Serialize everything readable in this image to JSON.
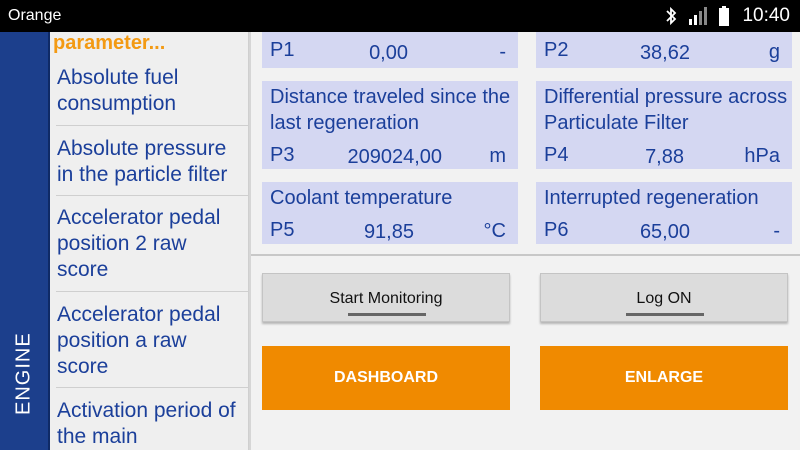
{
  "status_bar": {
    "carrier": "Orange",
    "time": "10:40"
  },
  "side_tab": {
    "label": "ENGINE"
  },
  "parameter_list": {
    "header": "parameter...",
    "items": [
      "Absolute fuel consumption",
      "Absolute pressure in the particle filter",
      "Accelerator pedal position 2 raw score",
      "Accelerator pedal position a raw score",
      "Activation period of the main"
    ]
  },
  "cells": {
    "p1": {
      "id": "P1",
      "value": "0,00",
      "unit": "-"
    },
    "p2": {
      "id": "P2",
      "value": "38,62",
      "unit": "g"
    },
    "p3": {
      "label": "Distance traveled since the last regeneration",
      "id": "P3",
      "value": "209024,00",
      "unit": "m"
    },
    "p4": {
      "label": "Differential pressure across Particulate Filter",
      "id": "P4",
      "value": "7,88",
      "unit": "hPa"
    },
    "p5": {
      "label": "Coolant temperature",
      "id": "P5",
      "value": "91,85",
      "unit": "°C"
    },
    "p6": {
      "label": "Interrupted regeneration",
      "id": "P6",
      "value": "65,00",
      "unit": "-"
    }
  },
  "buttons": {
    "start_monitoring": "Start Monitoring",
    "log_on": "Log ON",
    "dashboard": "DASHBOARD",
    "enlarge": "ENLARGE"
  },
  "colors": {
    "orange": "#f08a00",
    "engine_tab": "#1c3f8c",
    "cell_bg": "#d4d7f2",
    "text_blue": "#1b3f9a"
  }
}
